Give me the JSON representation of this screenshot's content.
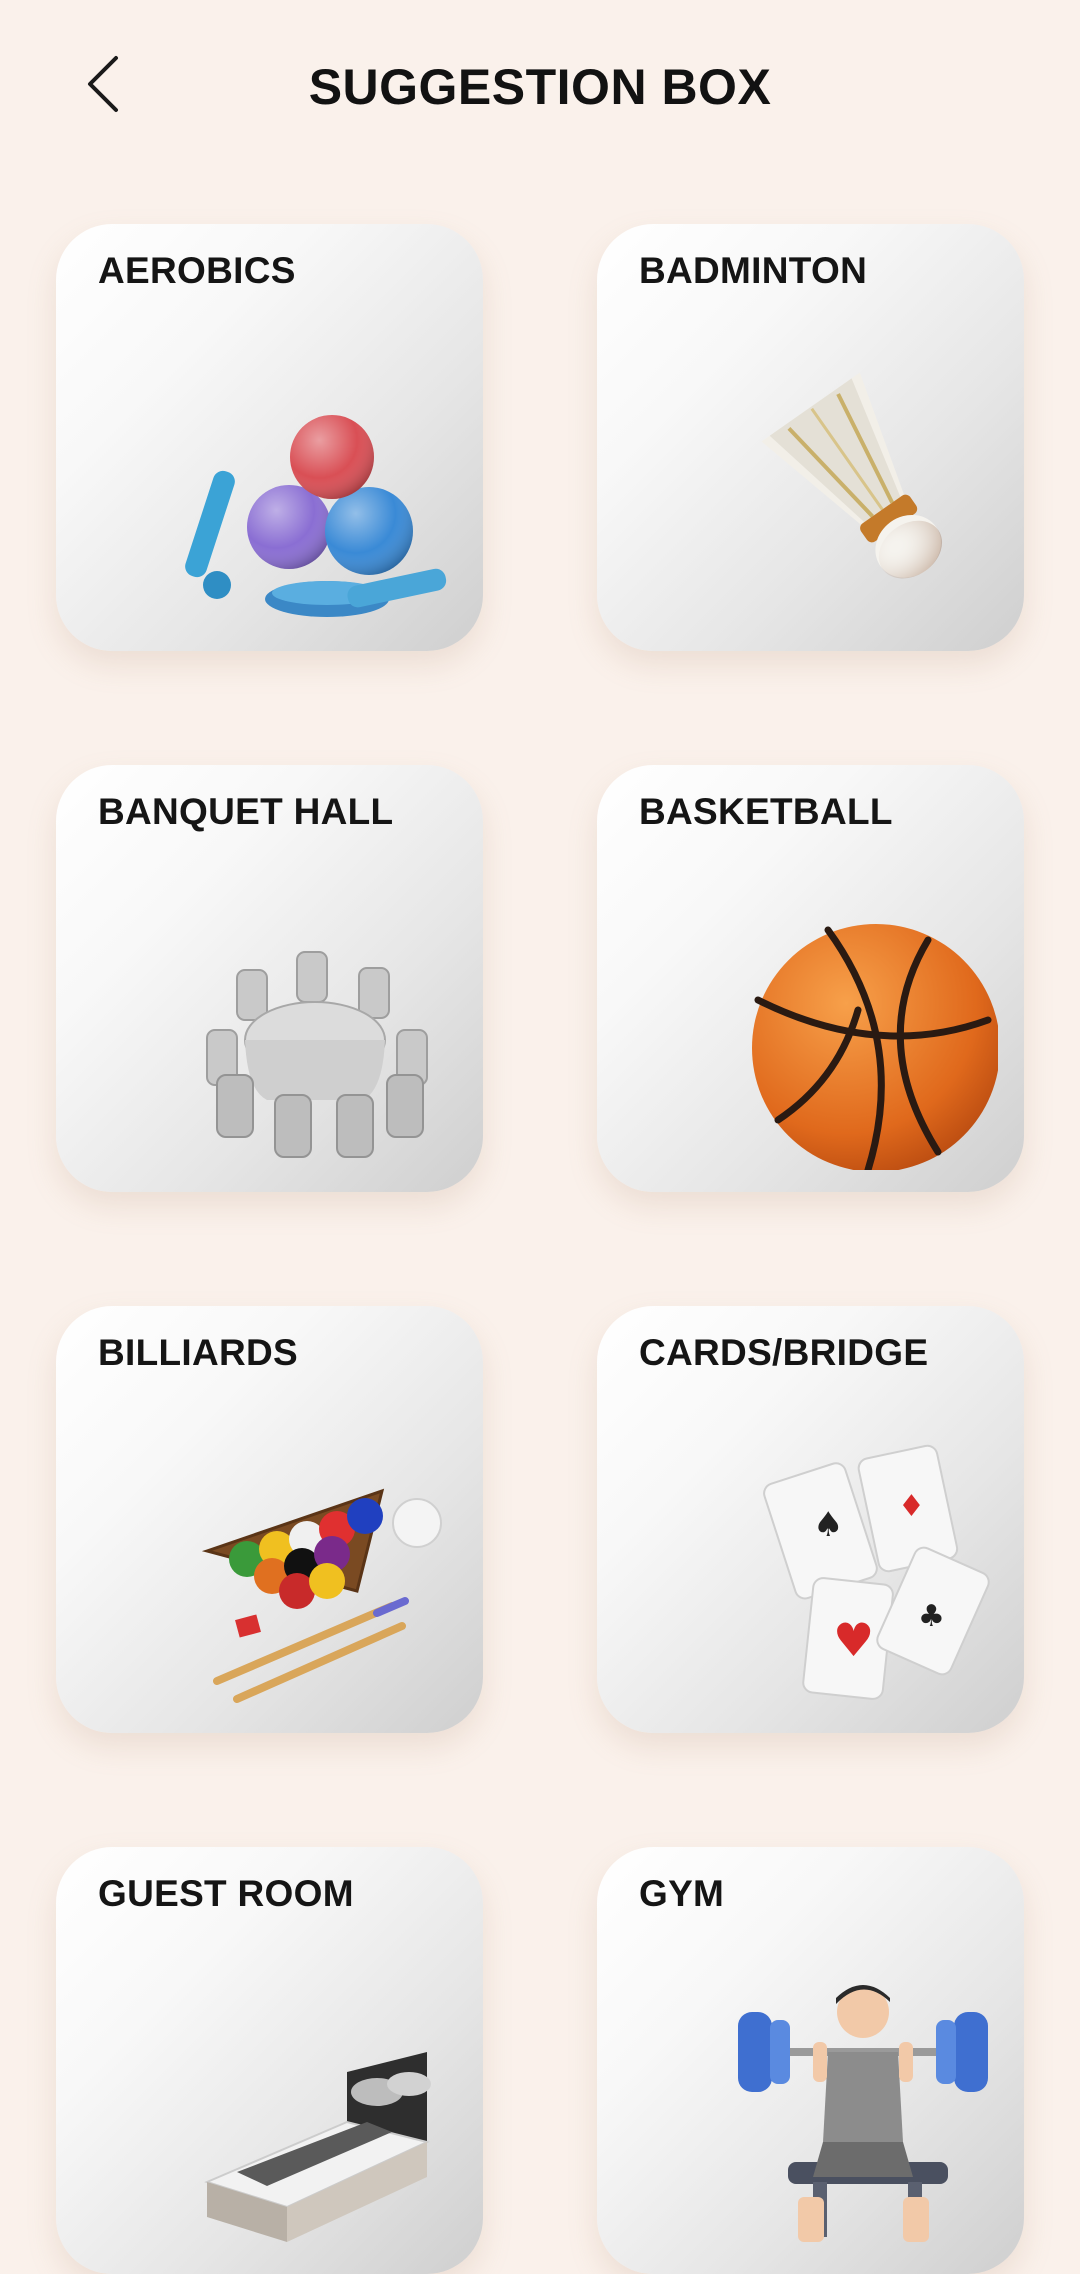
{
  "header": {
    "title": "SUGGESTION BOX",
    "back_icon": "chevron-left-icon"
  },
  "cards": [
    {
      "label": "AEROBICS",
      "icon": "aerobics-equipment-icon"
    },
    {
      "label": "BADMINTON",
      "icon": "shuttlecock-icon"
    },
    {
      "label": "BANQUET HALL",
      "icon": "banquet-table-icon"
    },
    {
      "label": "BASKETBALL",
      "icon": "basketball-icon"
    },
    {
      "label": "BILLIARDS",
      "icon": "billiard-balls-icon"
    },
    {
      "label": "CARDS/BRIDGE",
      "icon": "playing-cards-icon"
    },
    {
      "label": "GUEST ROOM",
      "icon": "bed-icon"
    },
    {
      "label": "GYM",
      "icon": "weightlifter-icon"
    }
  ],
  "colors": {
    "background": "#faf1eb",
    "card_top": "#ffffff",
    "card_bottom": "#cfcfcf",
    "text": "#151515"
  }
}
